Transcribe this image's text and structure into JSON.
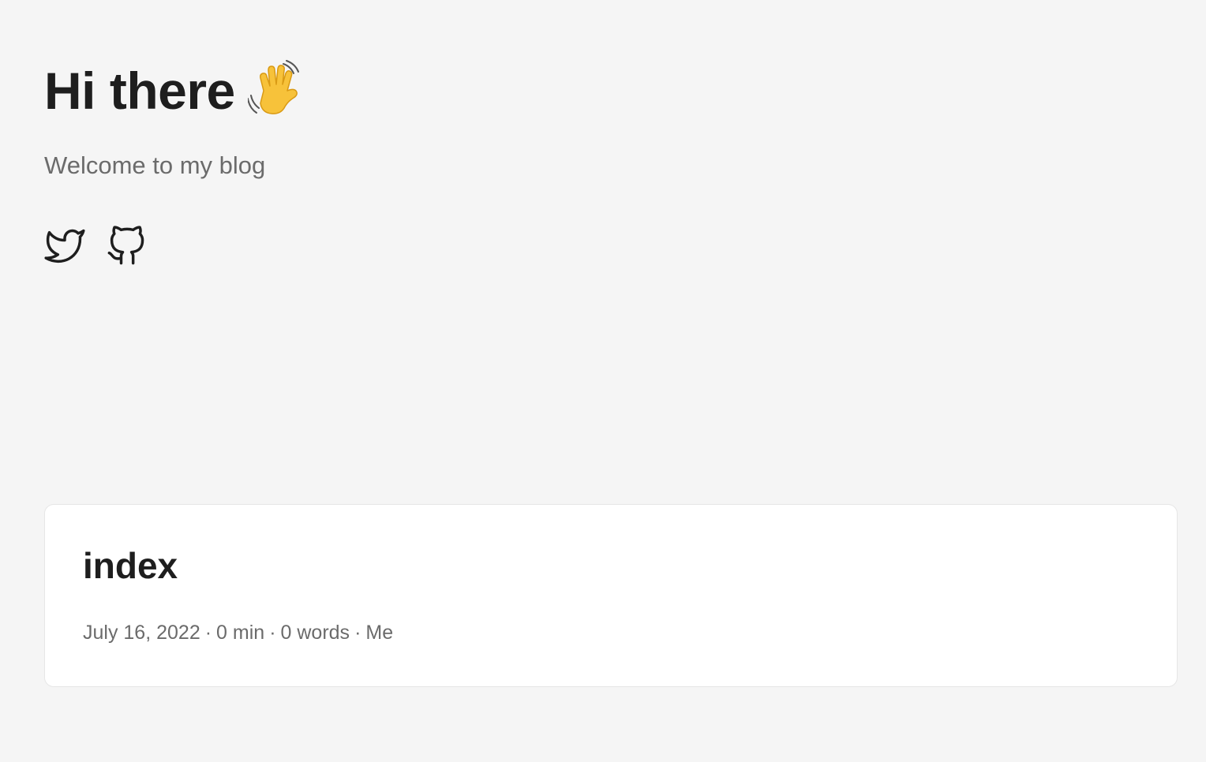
{
  "hero": {
    "title": "Hi there",
    "subtitle": "Welcome to my blog"
  },
  "social": [
    {
      "icon": "twitter-icon"
    },
    {
      "icon": "github-icon"
    }
  ],
  "posts": [
    {
      "title": "index",
      "date": "July 16, 2022",
      "reading_time": "0 min",
      "word_count": "0 words",
      "author": "Me",
      "separator": "·"
    }
  ],
  "colors": {
    "background": "#f5f5f5",
    "text": "#1e1e1e",
    "muted": "#6b6b6b",
    "card": "#ffffff"
  }
}
